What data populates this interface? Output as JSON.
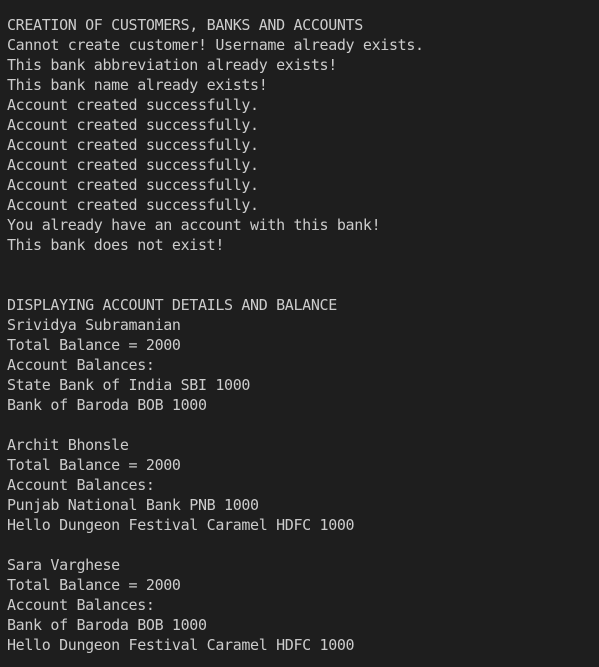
{
  "terminal": {
    "text_color": "#cccccc",
    "background_color": "#1e1e1e",
    "lines": [
      "CREATION OF CUSTOMERS, BANKS AND ACCOUNTS",
      "Cannot create customer! Username already exists.",
      "This bank abbreviation already exists!",
      "This bank name already exists!",
      "Account created successfully.",
      "Account created successfully.",
      "Account created successfully.",
      "Account created successfully.",
      "Account created successfully.",
      "Account created successfully.",
      "You already have an account with this bank!",
      "This bank does not exist!",
      "",
      "",
      "DISPLAYING ACCOUNT DETAILS AND BALANCE",
      "Srividya Subramanian",
      "Total Balance = 2000",
      "Account Balances:",
      "State Bank of India SBI 1000",
      "Bank of Baroda BOB 1000",
      "",
      "Archit Bhonsle",
      "Total Balance = 2000",
      "Account Balances:",
      "Punjab National Bank PNB 1000",
      "Hello Dungeon Festival Caramel HDFC 1000",
      "",
      "Sara Varghese",
      "Total Balance = 2000",
      "Account Balances:",
      "Bank of Baroda BOB 1000",
      "Hello Dungeon Festival Caramel HDFC 1000"
    ]
  }
}
